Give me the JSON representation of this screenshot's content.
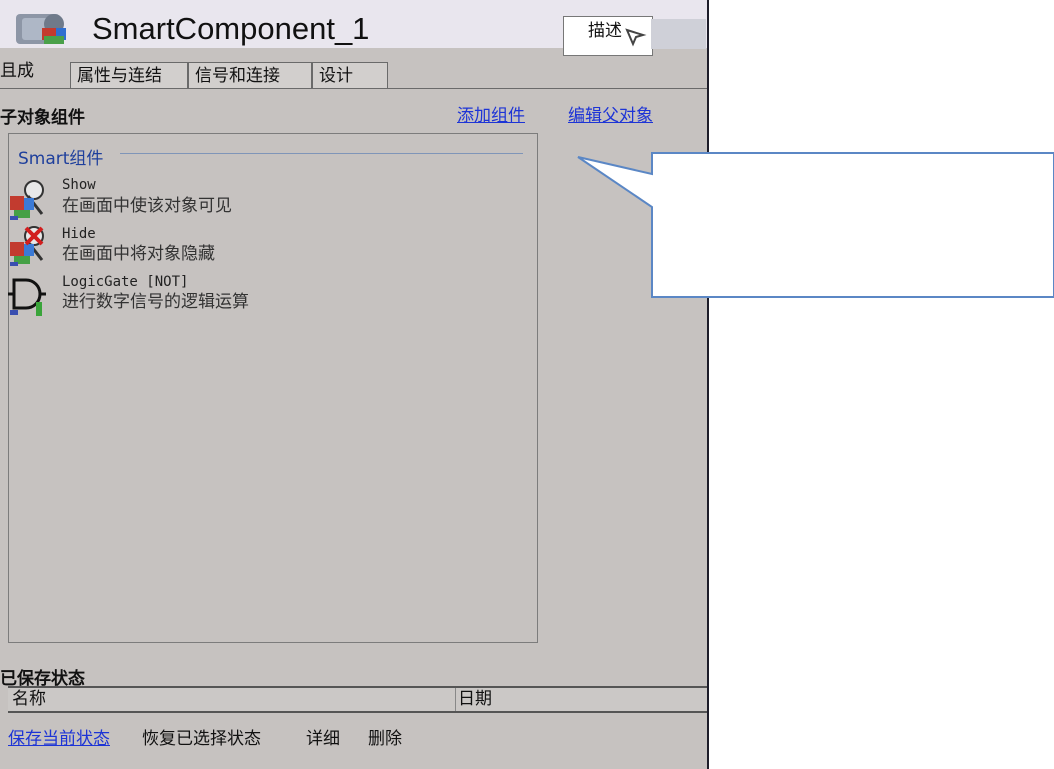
{
  "header": {
    "title": "SmartComponent_1",
    "description_label": "描述"
  },
  "tabs": [
    {
      "label": "组成",
      "visible_text": "且成"
    },
    {
      "label": "属性与连结"
    },
    {
      "label": "信号和连接"
    },
    {
      "label": "设计"
    }
  ],
  "children_section": {
    "title": "子对象组件",
    "add_component_link": "添加组件",
    "edit_parent_link": "编辑父对象"
  },
  "smart_group": {
    "title": "Smart组件",
    "components": [
      {
        "name": "Show",
        "description": "在画面中使该对象可见",
        "icon": "show-object-icon"
      },
      {
        "name": "Hide",
        "description": "在画面中将对象隐藏",
        "icon": "hide-object-icon"
      },
      {
        "name": "LogicGate [NOT]",
        "description": "进行数字信号的逻辑运算",
        "icon": "logic-gate-icon"
      }
    ]
  },
  "saved_states": {
    "title": "已保存状态",
    "columns": [
      "名称",
      "日期"
    ],
    "actions": {
      "save_current": "保存当前状态",
      "restore_selected": "恢复已选择状态",
      "details": "详细",
      "delete": "删除"
    }
  },
  "colors": {
    "panel_bg": "#c6c2c0",
    "link": "#1d34d6",
    "group_title": "#1e3f9c",
    "callout_border": "#5b87c5"
  }
}
